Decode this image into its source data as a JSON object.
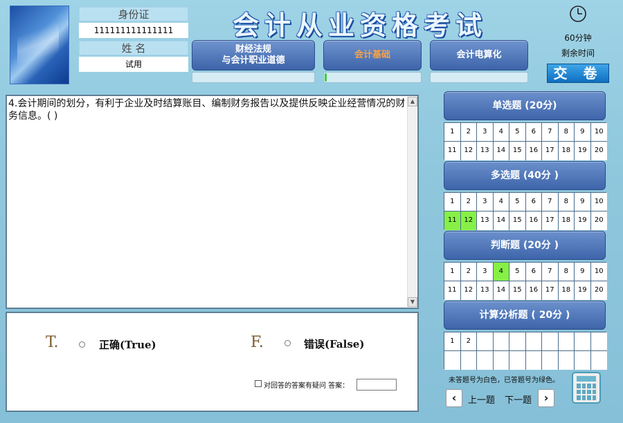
{
  "candidate": {
    "id_label": "身份证",
    "id_value": "111111111111111",
    "name_label": "姓  名",
    "name_value": "试用"
  },
  "exam_title": "会计从业资格考试",
  "subjects": [
    {
      "label": "财经法规\n与会计职业道德",
      "active": false,
      "progress": 0
    },
    {
      "label": "会计基础",
      "active": true,
      "progress": 0.02
    },
    {
      "label": "会计电算化",
      "active": false,
      "progress": 0
    }
  ],
  "timer": {
    "minutes": "60分钟",
    "remaining": "剩余时间",
    "icon": "clock-icon"
  },
  "submit_label": "交 卷",
  "question": {
    "text": "4.会计期间的划分，有利于企业及时结算账目、编制财务报告以及提供反映企业经营情况的财务信息。(   )"
  },
  "options": [
    {
      "letter": "T.",
      "text": "正确(True)"
    },
    {
      "letter": "F.",
      "text": "错误(False)"
    }
  ],
  "doubt": {
    "label": "对回答的答案有疑问 答案："
  },
  "sections": [
    {
      "title": "单选题 (20分)",
      "numbers": [
        "1",
        "2",
        "3",
        "4",
        "5",
        "6",
        "7",
        "8",
        "9",
        "10",
        "11",
        "12",
        "13",
        "14",
        "15",
        "16",
        "17",
        "18",
        "19",
        "20"
      ],
      "answered": []
    },
    {
      "title": "多选题 (40分 )",
      "numbers": [
        "1",
        "2",
        "3",
        "4",
        "5",
        "6",
        "7",
        "8",
        "9",
        "10",
        "11",
        "12",
        "13",
        "14",
        "15",
        "16",
        "17",
        "18",
        "19",
        "20"
      ],
      "answered": [
        "11",
        "12"
      ]
    },
    {
      "title": "判断题 (20分 )",
      "numbers": [
        "1",
        "2",
        "3",
        "4",
        "5",
        "6",
        "7",
        "8",
        "9",
        "10",
        "11",
        "12",
        "13",
        "14",
        "15",
        "16",
        "17",
        "18",
        "19",
        "20"
      ],
      "answered": [
        "4"
      ]
    },
    {
      "title": "计算分析题 ( 20分 )",
      "numbers": [
        "1",
        "2",
        "",
        "",
        "",
        "",
        "",
        "",
        "",
        "",
        "",
        "",
        "",
        "",
        "",
        "",
        "",
        "",
        "",
        ""
      ],
      "answered": []
    }
  ],
  "legend": "未答题号为白色，已答题号为绿色。",
  "nav": {
    "prev_label": "上一题",
    "next_label": "下一题",
    "prev_icon": "‹",
    "next_icon": "›"
  },
  "colors": {
    "answered": "#86f046",
    "accent": "#3e65aa",
    "active_tab": "#f7a24a"
  }
}
